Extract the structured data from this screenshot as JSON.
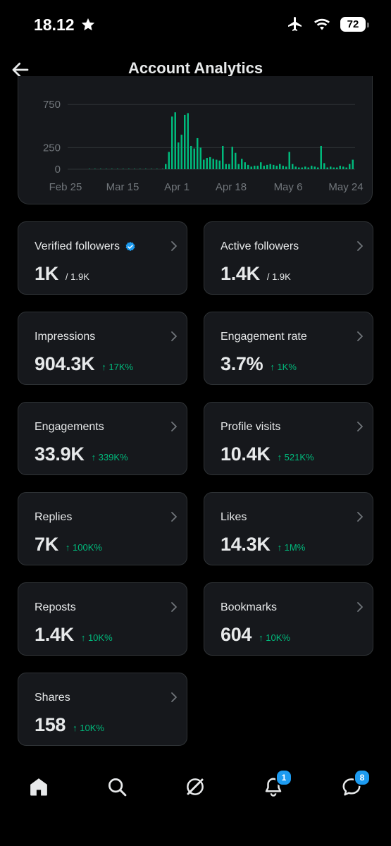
{
  "status_bar": {
    "time": "18.12",
    "battery": "72"
  },
  "header": {
    "title": "Account Analytics"
  },
  "chart_data": {
    "type": "bar",
    "series": [
      {
        "color": "#00ba7c"
      }
    ],
    "y_ticks": [
      "750",
      "250",
      "0"
    ],
    "y_tick_values": [
      750,
      250,
      0
    ],
    "ylim": [
      0,
      850
    ],
    "x_labels": [
      "Feb 25",
      "Mar 15",
      "Apr 1",
      "Apr 18",
      "May 6",
      "May 24"
    ],
    "x": [
      "Mar 28",
      "Mar 29",
      "Mar 30",
      "Mar 31",
      "Apr 1",
      "Apr 2",
      "Apr 3",
      "Apr 4",
      "Apr 5",
      "Apr 6",
      "Apr 7",
      "Apr 8",
      "Apr 9",
      "Apr 10",
      "Apr 11",
      "Apr 12",
      "Apr 13",
      "Apr 14",
      "Apr 15",
      "Apr 16",
      "Apr 17",
      "Apr 18",
      "Apr 19",
      "Apr 20",
      "Apr 21",
      "Apr 22",
      "Apr 23",
      "Apr 24",
      "Apr 25",
      "Apr 26",
      "Apr 27",
      "Apr 28",
      "Apr 29",
      "Apr 30",
      "May 1",
      "May 2",
      "May 3",
      "May 4",
      "May 5",
      "May 6",
      "May 7",
      "May 8",
      "May 9",
      "May 10",
      "May 11",
      "May 12",
      "May 13",
      "May 14",
      "May 15",
      "May 16",
      "May 17",
      "May 18",
      "May 19",
      "May 20",
      "May 21",
      "May 22",
      "May 23",
      "May 24",
      "May 25",
      "May 26"
    ],
    "values": [
      60,
      200,
      610,
      660,
      310,
      400,
      630,
      650,
      270,
      240,
      360,
      250,
      110,
      130,
      140,
      120,
      110,
      100,
      270,
      60,
      60,
      260,
      190,
      60,
      120,
      80,
      50,
      30,
      40,
      40,
      80,
      40,
      50,
      60,
      50,
      40,
      60,
      40,
      30,
      200,
      60,
      30,
      20,
      20,
      30,
      20,
      40,
      30,
      20,
      270,
      70,
      20,
      30,
      20,
      20,
      40,
      30,
      20,
      60,
      110
    ],
    "grid": true
  },
  "cards": [
    {
      "label": "Verified followers",
      "value": "1K",
      "sub": "/ 1.9K",
      "delta": "",
      "verified": true
    },
    {
      "label": "Active followers",
      "value": "1.4K",
      "sub": "/ 1.9K",
      "delta": "",
      "verified": false
    },
    {
      "label": "Impressions",
      "value": "904.3K",
      "sub": "",
      "delta": "↑ 17K%",
      "verified": false
    },
    {
      "label": "Engagement rate",
      "value": "3.7%",
      "sub": "",
      "delta": "↑ 1K%",
      "verified": false
    },
    {
      "label": "Engagements",
      "value": "33.9K",
      "sub": "",
      "delta": "↑ 339K%",
      "verified": false
    },
    {
      "label": "Profile visits",
      "value": "10.4K",
      "sub": "",
      "delta": "↑ 521K%",
      "verified": false
    },
    {
      "label": "Replies",
      "value": "7K",
      "sub": "",
      "delta": "↑ 100K%",
      "verified": false
    },
    {
      "label": "Likes",
      "value": "14.3K",
      "sub": "",
      "delta": "↑ 1M%",
      "verified": false
    },
    {
      "label": "Reposts",
      "value": "1.4K",
      "sub": "",
      "delta": "↑ 10K%",
      "verified": false
    },
    {
      "label": "Bookmarks",
      "value": "604",
      "sub": "",
      "delta": "↑ 10K%",
      "verified": false
    },
    {
      "label": "Shares",
      "value": "158",
      "sub": "",
      "delta": "↑ 10K%",
      "verified": false
    }
  ],
  "nav": {
    "notifications_badge": "1",
    "messages_badge": "8",
    "icons": [
      "home-icon",
      "search-icon",
      "grok-icon",
      "bell-icon",
      "messages-icon"
    ]
  },
  "colors": {
    "accent": "#1d9bf0",
    "positive": "#00ba7c",
    "card_bg": "#16181c",
    "border": "#2f3336"
  }
}
